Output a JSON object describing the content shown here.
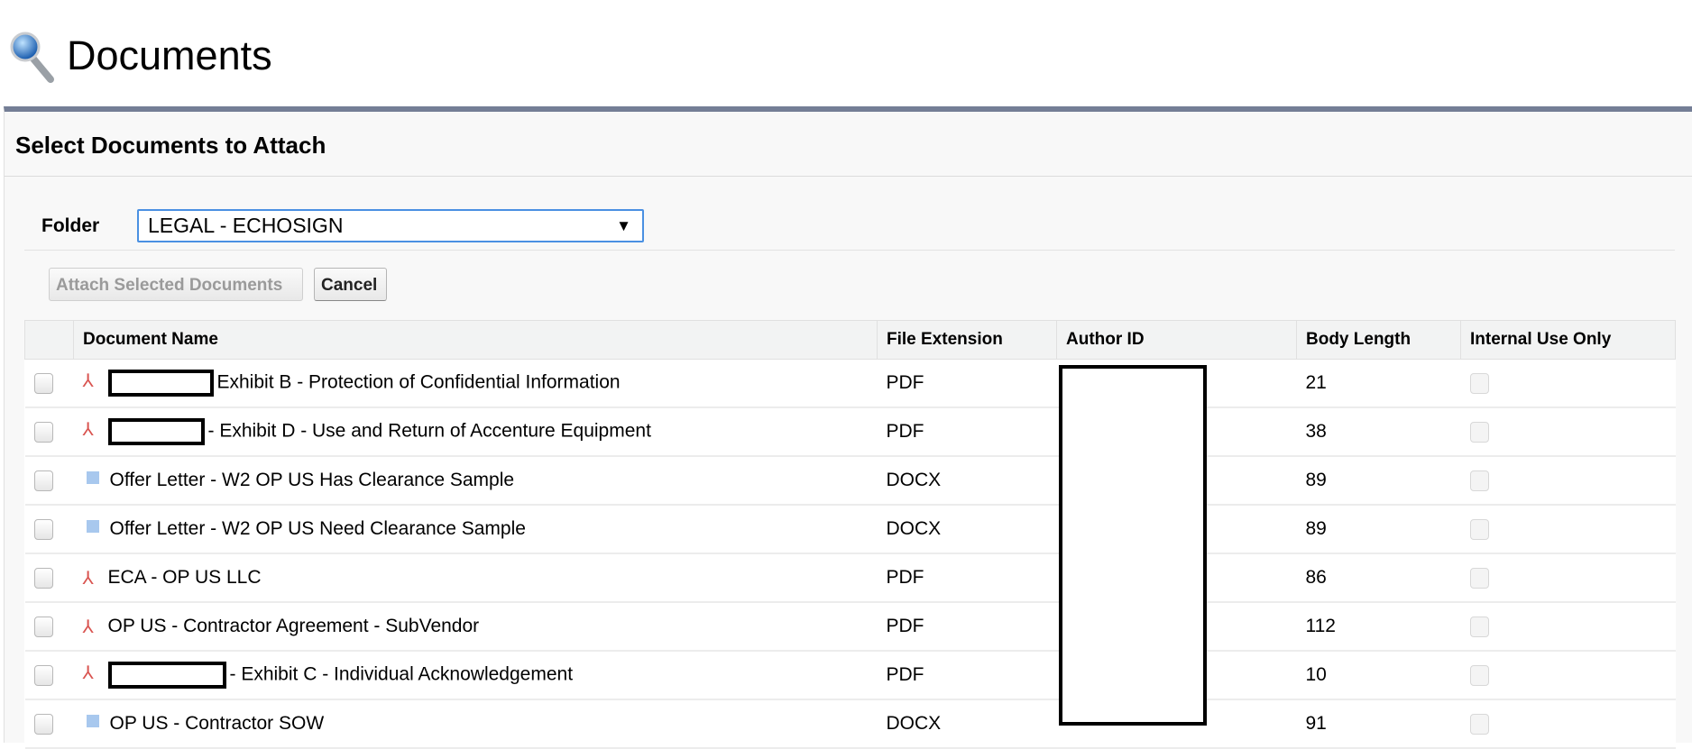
{
  "page": {
    "title": "Documents",
    "icon": "magnifier-icon"
  },
  "panel": {
    "heading": "Select Documents to Attach"
  },
  "folder": {
    "label": "Folder",
    "selected": "LEGAL - ECHOSIGN",
    "arrow": "▼"
  },
  "buttons": {
    "attach": "Attach Selected Documents",
    "cancel": "Cancel"
  },
  "table": {
    "headers": [
      "Document Name",
      "File Extension",
      "Author ID",
      "Body Length",
      "Internal Use Only"
    ],
    "rows": [
      {
        "redacted_prefix": true,
        "name": "Exhibit B - Protection of Confidential Information",
        "ext": "PDF",
        "length": "21",
        "icon": "pdf-icon"
      },
      {
        "redacted_prefix": true,
        "name": "- Exhibit D - Use and Return of Accenture Equipment",
        "ext": "PDF",
        "length": "38",
        "icon": "pdf-icon"
      },
      {
        "redacted_prefix": false,
        "name": "Offer Letter - W2 OP US Has Clearance Sample",
        "ext": "DOCX",
        "length": "89",
        "icon": "docx-icon"
      },
      {
        "redacted_prefix": false,
        "name": "Offer Letter - W2 OP US Need Clearance Sample",
        "ext": "DOCX",
        "length": "89",
        "icon": "docx-icon"
      },
      {
        "redacted_prefix": false,
        "name": "ECA - OP US LLC",
        "ext": "PDF",
        "length": "86",
        "icon": "pdf-icon"
      },
      {
        "redacted_prefix": false,
        "name": "OP US - Contractor Agreement - SubVendor",
        "ext": "PDF",
        "length": "112",
        "icon": "pdf-icon"
      },
      {
        "redacted_prefix": true,
        "name": "- Exhibit C - Individual Acknowledgement",
        "ext": "PDF",
        "length": "10",
        "icon": "pdf-icon"
      },
      {
        "redacted_prefix": false,
        "name": "OP US - Contractor SOW",
        "ext": "DOCX",
        "length": "91",
        "icon": "docx-icon"
      }
    ]
  }
}
